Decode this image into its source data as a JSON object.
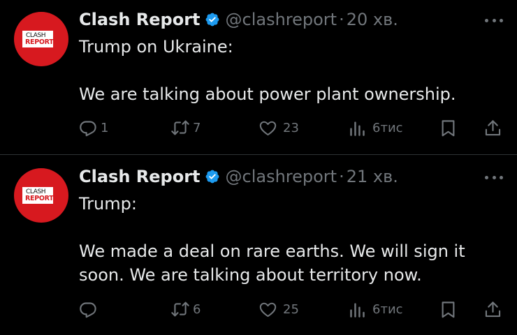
{
  "tweets": [
    {
      "avatar": {
        "line1": "CLASH",
        "line2": "REPORT"
      },
      "name": "Clash Report",
      "handle": "@clashreport",
      "separator": "·",
      "time": "20 хв.",
      "text_lines": [
        "Trump on Ukraine:",
        "",
        "We are talking about power plant ownership."
      ],
      "actions": {
        "replies": "1",
        "reposts": "7",
        "likes": "23",
        "views": "6тис"
      }
    },
    {
      "avatar": {
        "line1": "CLASH",
        "line2": "REPORT"
      },
      "name": "Clash Report",
      "handle": "@clashreport",
      "separator": "·",
      "time": "21 хв.",
      "text_lines": [
        "Trump:",
        "",
        "We made a deal on rare earths. We will sign it",
        "soon. We are talking about territory now."
      ],
      "actions": {
        "replies": "",
        "reposts": "6",
        "likes": "25",
        "views": "6тис"
      }
    }
  ],
  "colors": {
    "background": "#000000",
    "text": "#e7e9ea",
    "secondary": "#71767b",
    "verified": "#1d9bf0",
    "avatar_red": "#d7191f",
    "divider": "#2f3336"
  },
  "icons": [
    "verified-badge-icon",
    "more-icon",
    "reply-icon",
    "repost-icon",
    "like-icon",
    "views-icon",
    "bookmark-icon",
    "share-icon"
  ]
}
